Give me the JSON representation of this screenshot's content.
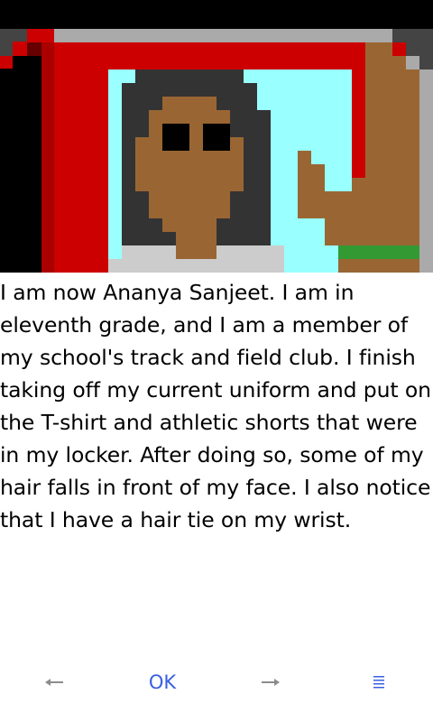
{
  "story": {
    "paragraph": "I am now Ananya Sanjeet. I am in eleventh grade, and I am a member of my school's track and field club. I finish taking off my current uniform and put on the T-shirt and athletic shorts that were in my locker. After doing so, some of my hair falls in front of my face. I also notice that I have a hair tie on my wrist."
  },
  "nav": {
    "back_icon": "arrow-left-icon",
    "ok_label": "OK",
    "forward_icon": "arrow-right-icon",
    "menu_icon": "menu-lines-icon"
  },
  "colors": {
    "accent": "#3a5fe0",
    "icon_gray": "#8c8c8c",
    "skin": "#996633",
    "hair": "#333333",
    "frame_red": "#cc0000",
    "sky": "#99ffff",
    "band_green": "#339933"
  }
}
